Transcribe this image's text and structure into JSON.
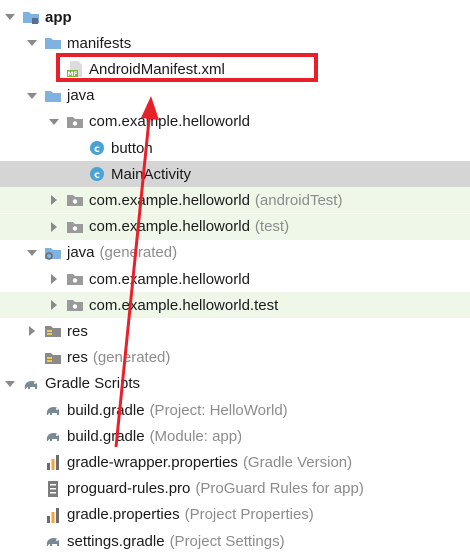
{
  "tree": [
    {
      "label": "app",
      "bold": true,
      "icon": "module-folder-icon",
      "arrow": "down",
      "indent": 0
    },
    {
      "label": "manifests",
      "icon": "folder-icon",
      "arrow": "down",
      "indent": 1
    },
    {
      "label": "AndroidManifest.xml",
      "icon": "manifest-file-icon",
      "arrow": "none",
      "indent": 2
    },
    {
      "label": "java",
      "icon": "source-folder-icon",
      "arrow": "down",
      "indent": 1
    },
    {
      "label": "com.example.helloworld",
      "icon": "package-icon",
      "arrow": "down",
      "indent": 2
    },
    {
      "label": "button",
      "icon": "class-icon",
      "arrow": "none",
      "indent": 3
    },
    {
      "label": "MainActivity",
      "icon": "class-icon",
      "arrow": "none",
      "indent": 3,
      "selected": true
    },
    {
      "label": "com.example.helloworld",
      "hint": "(androidTest)",
      "icon": "package-icon",
      "arrow": "right",
      "indent": 2,
      "test": true
    },
    {
      "label": "com.example.helloworld",
      "hint": "(test)",
      "icon": "package-icon",
      "arrow": "right",
      "indent": 2,
      "test": true
    },
    {
      "label": "java",
      "hint": "(generated)",
      "icon": "generated-source-folder-icon",
      "arrow": "down",
      "indent": 1
    },
    {
      "label": "com.example.helloworld",
      "icon": "package-icon",
      "arrow": "right",
      "indent": 2
    },
    {
      "label": "com.example.helloworld.test",
      "icon": "package-icon",
      "arrow": "right",
      "indent": 2,
      "test": true
    },
    {
      "label": "res",
      "icon": "resource-folder-icon",
      "arrow": "right",
      "indent": 1
    },
    {
      "label": "res",
      "hint": "(generated)",
      "icon": "resource-folder-icon",
      "arrow": "none",
      "indent": 1
    },
    {
      "label": "Gradle Scripts",
      "icon": "gradle-elephant-icon",
      "arrow": "down",
      "indent": 0
    },
    {
      "label": "build.gradle",
      "hint": "(Project: HelloWorld)",
      "icon": "gradle-elephant-icon",
      "arrow": "none",
      "indent": 1
    },
    {
      "label": "build.gradle",
      "hint": "(Module: app)",
      "icon": "gradle-elephant-icon",
      "arrow": "none",
      "indent": 1
    },
    {
      "label": "gradle-wrapper.properties",
      "hint": "(Gradle Version)",
      "icon": "properties-file-icon",
      "arrow": "none",
      "indent": 1
    },
    {
      "label": "proguard-rules.pro",
      "hint": "(ProGuard Rules for app)",
      "icon": "text-file-icon",
      "arrow": "none",
      "indent": 1
    },
    {
      "label": "gradle.properties",
      "hint": "(Project Properties)",
      "icon": "properties-file-icon",
      "arrow": "none",
      "indent": 1
    },
    {
      "label": "settings.gradle",
      "hint": "(Project Settings)",
      "icon": "gradle-elephant-icon",
      "arrow": "none",
      "indent": 1
    }
  ],
  "colors": {
    "selected": "#d5d5d5",
    "test_background": "#eef7e8",
    "annotation_red": "#e8202a",
    "hint_gray": "#8c8c8c",
    "folder_blue": "#7fb2e0",
    "class_teal": "#4aa3d6",
    "manifest_green": "#7cb342"
  }
}
